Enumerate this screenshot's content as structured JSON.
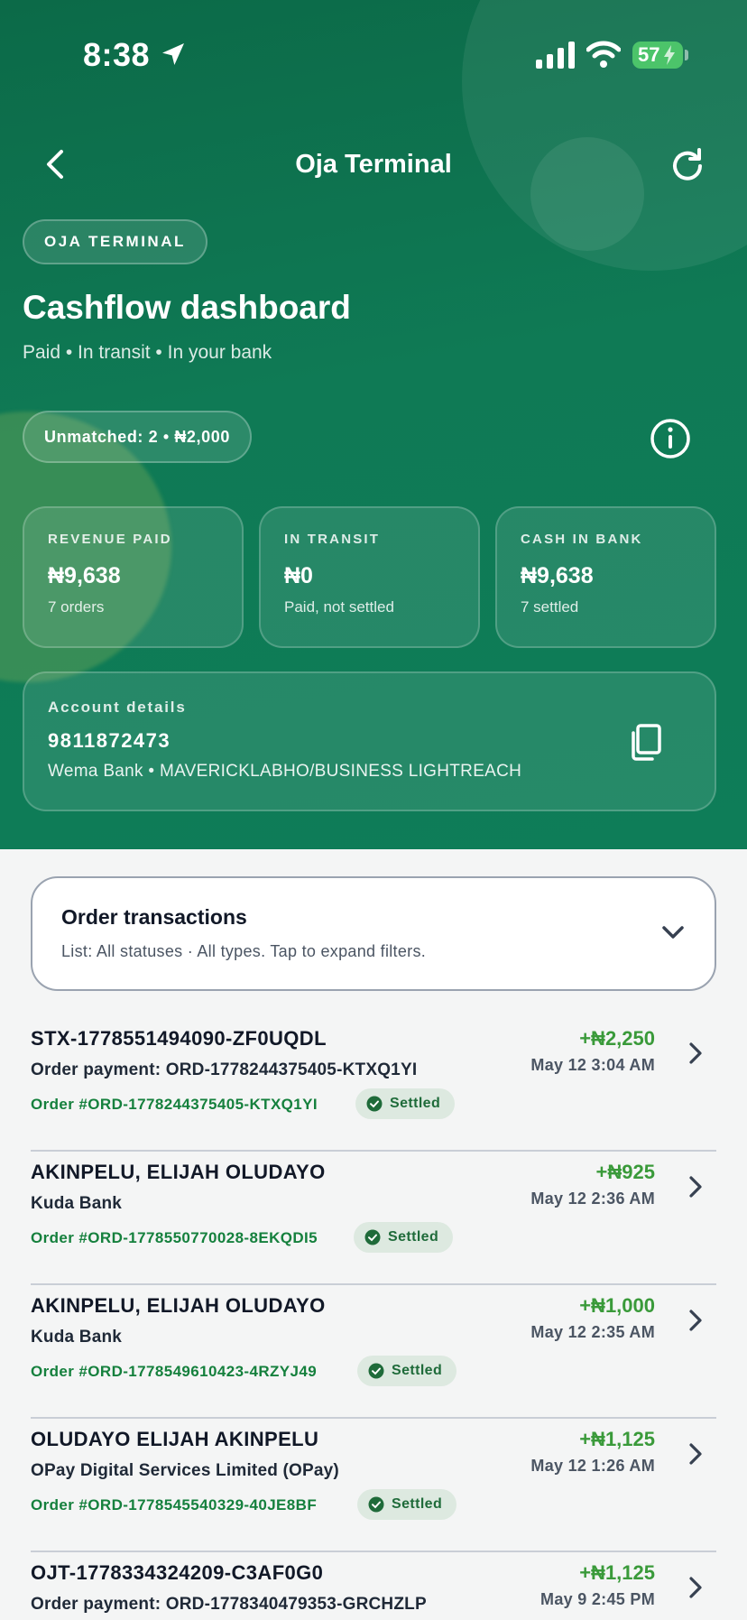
{
  "status_bar": {
    "time": "8:38",
    "battery": "57"
  },
  "nav": {
    "title": "Oja Terminal"
  },
  "hero": {
    "tag": "OJA TERMINAL",
    "title": "Cashflow dashboard",
    "subtitle": "Paid • In transit • In your bank",
    "unmatched": "Unmatched: 2 • ₦2,000"
  },
  "stats": [
    {
      "label": "REVENUE PAID",
      "value": "₦9,638",
      "sub": "7 orders"
    },
    {
      "label": "IN TRANSIT",
      "value": "₦0",
      "sub": "Paid, not settled"
    },
    {
      "label": "CASH IN BANK",
      "value": "₦9,638",
      "sub": "7 settled"
    }
  ],
  "account": {
    "label": "Account details",
    "number": "9811872473",
    "bank": "Wema Bank • MAVERICKLABHO/BUSINESS LIGHTREACH"
  },
  "filter": {
    "title": "Order transactions",
    "subtitle": "List: All statuses · All types. Tap to expand filters."
  },
  "transactions": [
    {
      "name": "STX-1778551494090-ZF0UQDL",
      "desc": "Order payment: ORD-1778244375405-KTXQ1YI",
      "order": "Order #ORD-1778244375405-KTXQ1YI",
      "status": "Settled",
      "amount": "+₦2,250",
      "date": "May 12 3:04 AM"
    },
    {
      "name": "AKINPELU, ELIJAH OLUDAYO",
      "desc": "Kuda Bank",
      "order": "Order #ORD-1778550770028-8EKQDI5",
      "status": "Settled",
      "amount": "+₦925",
      "date": "May 12 2:36 AM"
    },
    {
      "name": "AKINPELU, ELIJAH OLUDAYO",
      "desc": "Kuda Bank",
      "order": "Order #ORD-1778549610423-4RZYJ49",
      "status": "Settled",
      "amount": "+₦1,000",
      "date": "May 12 2:35 AM"
    },
    {
      "name": "OLUDAYO ELIJAH AKINPELU",
      "desc": "OPay Digital Services Limited (OPay)",
      "order": "Order #ORD-1778545540329-40JE8BF",
      "status": "Settled",
      "amount": "+₦1,125",
      "date": "May 12 1:26 AM"
    },
    {
      "name": "OJT-1778334324209-C3AF0G0",
      "desc": "Order payment: ORD-1778340479353-GRCHZLP",
      "order": "",
      "status": "",
      "amount": "+₦1,125",
      "date": "May 9 2:45 PM"
    }
  ],
  "colors": {
    "hero_green": "#0f7a55",
    "amount_green": "#3a9a3a",
    "order_green": "#15803d",
    "badge_bg": "#dde9e0"
  }
}
